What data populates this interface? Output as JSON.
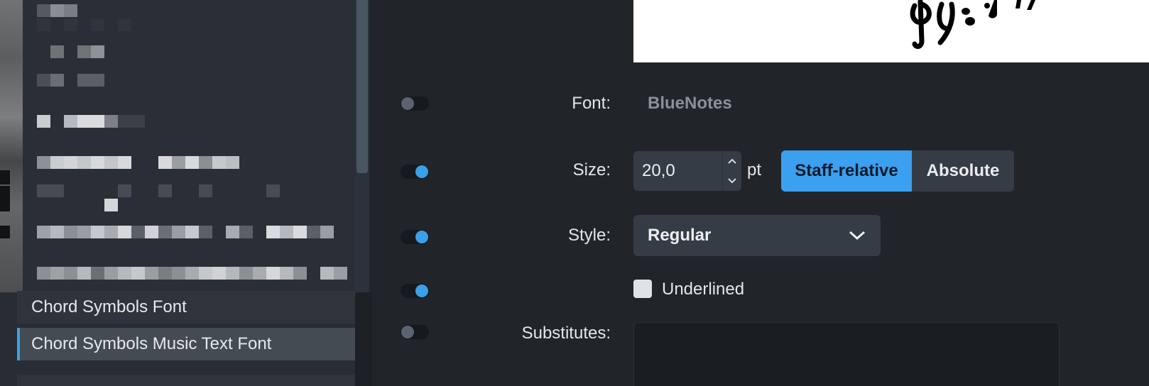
{
  "font_list": {
    "items": [
      {
        "label": "Chord Symbols Font",
        "selected": false
      },
      {
        "label": "Chord Symbols Music Text Font",
        "selected": true
      }
    ]
  },
  "settings": {
    "font": {
      "label": "Font:",
      "value": "BlueNotes",
      "override_enabled": false
    },
    "size": {
      "label": "Size:",
      "value": "20,0",
      "unit": "pt",
      "override_enabled": true,
      "modes": [
        "Staff-relative",
        "Absolute"
      ],
      "active_mode": "Staff-relative"
    },
    "style": {
      "label": "Style:",
      "value": "Regular",
      "override_enabled": true
    },
    "underlined": {
      "label": "Underlined",
      "checked": false,
      "override_enabled": true
    },
    "substitutes": {
      "label": "Substitutes:",
      "override_enabled": false
    }
  },
  "colors": {
    "accent": "#3aa0ef",
    "panel_bg": "#21252a",
    "list_bg": "#2f343c"
  },
  "icons": [
    "chevron-up-icon",
    "chevron-down-icon",
    "dropdown-chevron-icon",
    "music-notation-preview"
  ]
}
